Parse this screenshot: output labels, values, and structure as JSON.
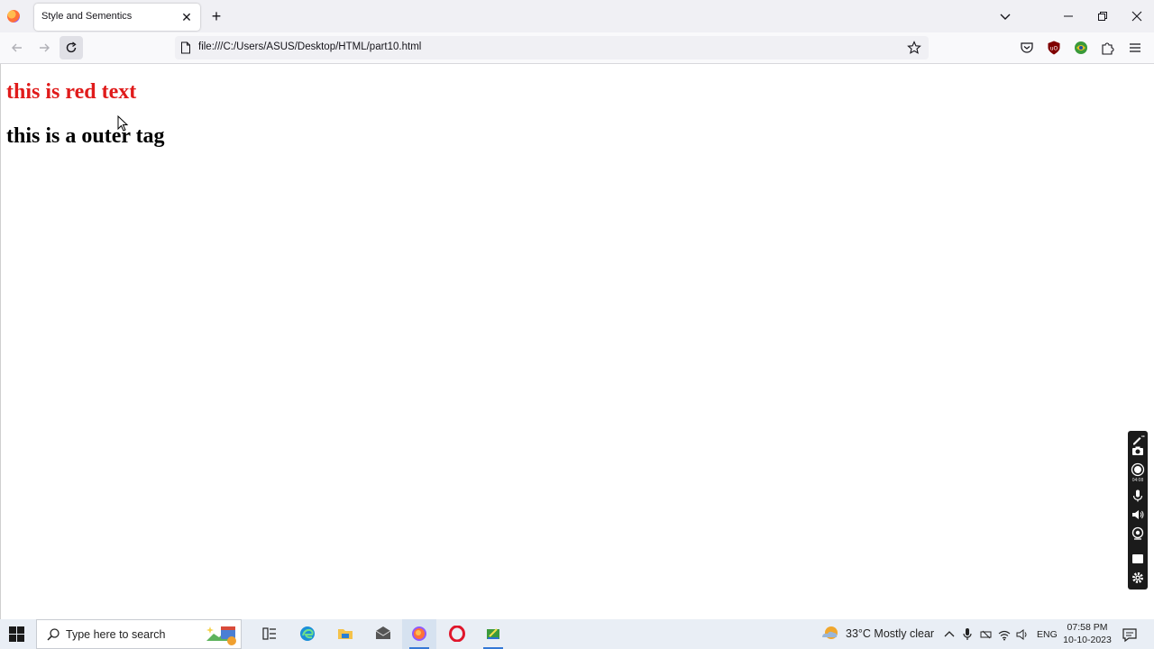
{
  "browser": {
    "tab": {
      "title": "Style and Sementics",
      "close_glyph": "✕"
    },
    "new_tab_glyph": "+",
    "address": "file:///C:/Users/ASUS/Desktop/HTML/part10.html"
  },
  "page": {
    "red_text": "this is red text",
    "red_color": "#e01b1b",
    "outer_text": "this is a outer tag"
  },
  "recorder": {
    "time": "04:08"
  },
  "taskbar": {
    "search_placeholder": "Type here to search",
    "weather": "33°C  Mostly clear",
    "language": "ENG",
    "time": "07:58 PM",
    "date": "10-10-2023"
  },
  "colors": {
    "accent": "#3478d6",
    "tab_bg": "#f0f0f4",
    "taskbar_bg": "#e9eef5"
  },
  "icons": [
    "firefox-icon",
    "close-icon",
    "plus-icon",
    "chevron-down-icon",
    "minimize-icon",
    "restore-icon",
    "back-icon",
    "forward-icon",
    "reload-icon",
    "page-icon",
    "star-icon",
    "pocket-icon",
    "ublock-icon",
    "extension-icon",
    "puzzle-icon",
    "menu-icon",
    "windows-icon",
    "search-icon",
    "task-view-icon",
    "edge-icon",
    "file-explorer-icon",
    "mail-icon",
    "opera-icon",
    "app-icon",
    "weather-icon",
    "mic-icon",
    "notification-icon"
  ]
}
